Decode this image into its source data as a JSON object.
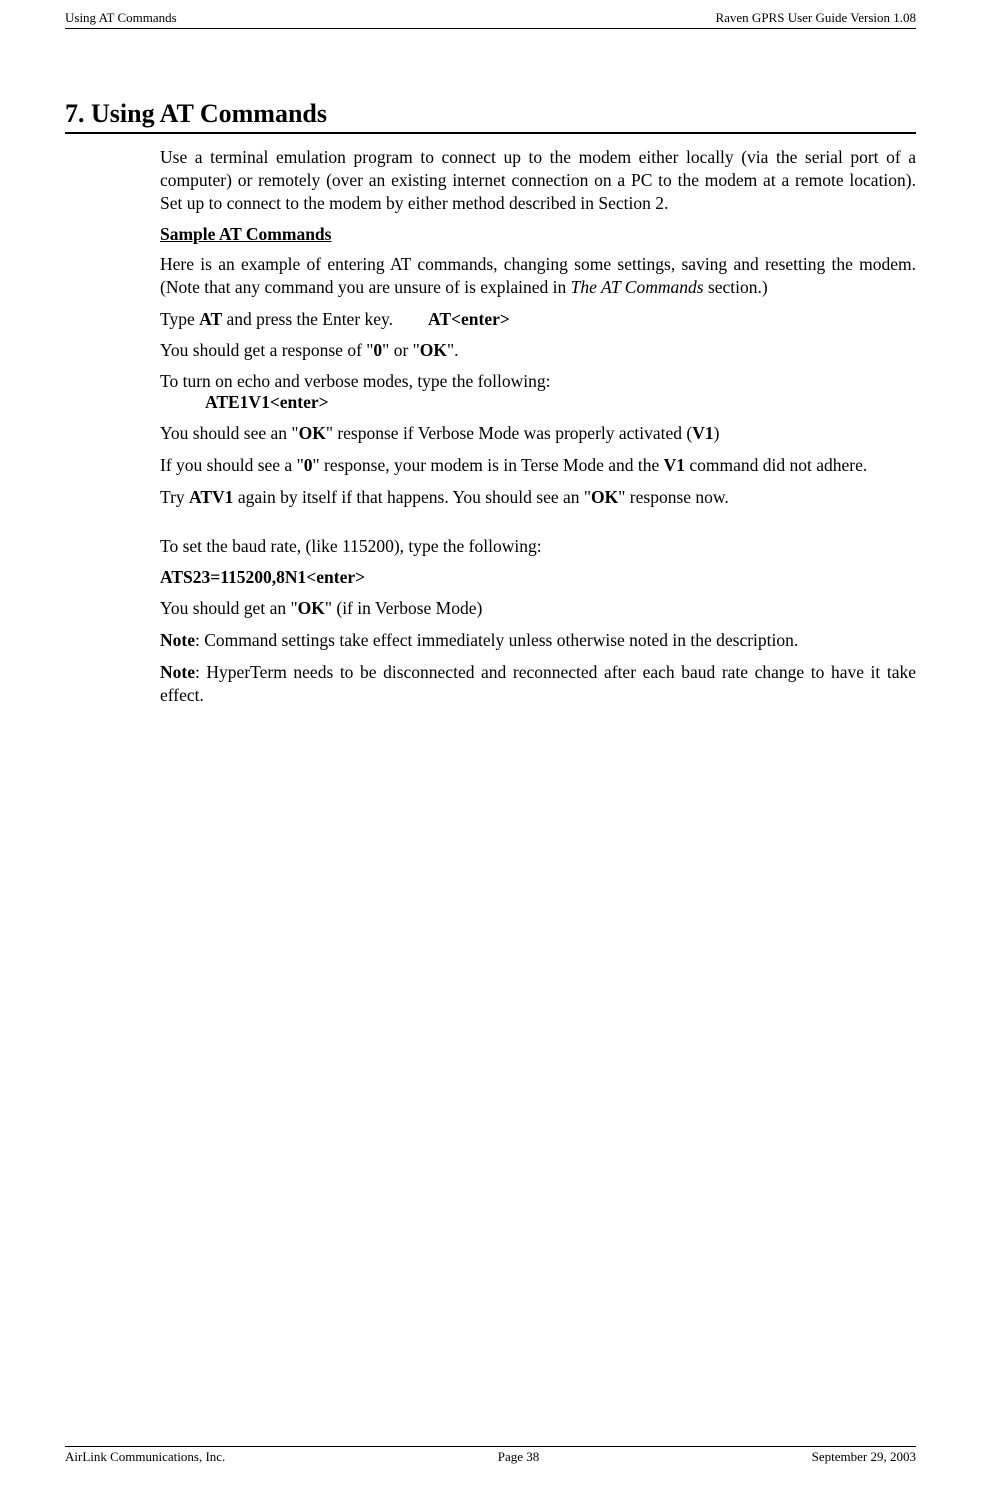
{
  "header": {
    "left": "Using AT Commands",
    "right": "Raven GPRS User Guide Version 1.08"
  },
  "section": {
    "title": "7.  Using AT Commands",
    "intro": "Use a terminal emulation program to connect up to the modem either locally (via the serial port of a computer) or remotely (over an existing internet connection on a PC to the modem at a remote location). Set up to connect to the modem by either method described in Section 2.",
    "subtitle": "Sample AT Commands",
    "p1_pre": "Here is an example of entering AT commands, changing some settings, saving and resetting the modem. (Note that any command you are unsure of is explained in ",
    "p1_italic": "The AT Commands",
    "p1_post": " section.)",
    "p2_pre": "Type ",
    "p2_b1": "AT",
    "p2_mid": " and press the Enter key.        ",
    "p2_b2": "AT<enter>",
    "p3_pre": "You should get a response of \"",
    "p3_b1": "0",
    "p3_mid": "\" or \"",
    "p3_b2": "OK",
    "p3_post": "\".",
    "p4": "To turn on echo and verbose modes, type the following:",
    "p4_cmd": "ATE1V1<enter>",
    "p5_pre": "You should see an \"",
    "p5_b1": "OK",
    "p5_mid": "\" response if Verbose Mode was properly activated (",
    "p5_b2": "V1",
    "p5_post": ")",
    "p6_pre": "If you should see a \"",
    "p6_b1": "0",
    "p6_mid": "\" response, your modem is in Terse Mode and the ",
    "p6_b2": "V1",
    "p6_post": " command did not adhere.",
    "p7_pre": "Try ",
    "p7_b1": "ATV1",
    "p7_mid": " again by itself if that happens. You should see an \"",
    "p7_b2": "OK",
    "p7_post": "\" response now.",
    "p8": "To set the baud rate, (like 115200), type the following:",
    "p9": "ATS23=115200,8N1<enter>",
    "p10_pre": "You should get an \"",
    "p10_b": "OK",
    "p10_post": "\" (if in Verbose Mode)",
    "p11_b": "Note",
    "p11": ": Command settings take effect immediately unless otherwise noted in the description.",
    "p12_b": "Note",
    "p12": ": HyperTerm needs to be disconnected and reconnected after each baud rate change to have it take effect."
  },
  "footer": {
    "left": "AirLink Communications, Inc.",
    "center": "Page 38",
    "right": "September 29, 2003"
  }
}
